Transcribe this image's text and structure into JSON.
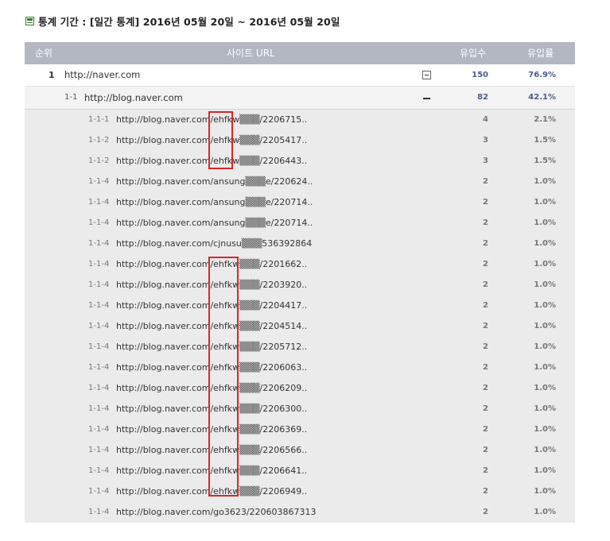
{
  "header": {
    "text": "통계 기간 : [일간 통계] 2016년 05월 20일 ~ 2016년 05월 20일"
  },
  "table": {
    "columns": {
      "rank": "순위",
      "url": "사이트 URL",
      "count": "유입수",
      "rate": "유입률"
    },
    "top": {
      "rank": "1",
      "url": "http://naver.com",
      "count": "150",
      "rate": "76.9%"
    },
    "sub": {
      "rank": "1-1",
      "url": "http://blog.naver.com",
      "count": "82",
      "rate": "42.1%"
    },
    "rows": [
      {
        "rank": "1-1-1",
        "url": "http://blog.naver.com/ehfkw▒▒▒/2206715..",
        "count": "4",
        "rate": "2.1%"
      },
      {
        "rank": "1-1-2",
        "url": "http://blog.naver.com/ehfkw▒▒▒/2205417..",
        "count": "3",
        "rate": "1.5%"
      },
      {
        "rank": "1-1-2",
        "url": "http://blog.naver.com/ehfkw▒▒▒/2206443..",
        "count": "3",
        "rate": "1.5%"
      },
      {
        "rank": "1-1-4",
        "url": "http://blog.naver.com/ansung▒▒▒e/220624..",
        "count": "2",
        "rate": "1.0%"
      },
      {
        "rank": "1-1-4",
        "url": "http://blog.naver.com/ansung▒▒▒e/220714..",
        "count": "2",
        "rate": "1.0%"
      },
      {
        "rank": "1-1-4",
        "url": "http://blog.naver.com/ansung▒▒▒e/220714..",
        "count": "2",
        "rate": "1.0%"
      },
      {
        "rank": "1-1-4",
        "url": "http://blog.naver.com/cjnusu▒▒▒536392864",
        "count": "2",
        "rate": "1.0%"
      },
      {
        "rank": "1-1-4",
        "url": "http://blog.naver.com/ehfkw▒▒▒/2201662..",
        "count": "2",
        "rate": "1.0%"
      },
      {
        "rank": "1-1-4",
        "url": "http://blog.naver.com/ehfkw▒▒▒/2203920..",
        "count": "2",
        "rate": "1.0%"
      },
      {
        "rank": "1-1-4",
        "url": "http://blog.naver.com/ehfkw▒▒▒/2204417..",
        "count": "2",
        "rate": "1.0%"
      },
      {
        "rank": "1-1-4",
        "url": "http://blog.naver.com/ehfkw▒▒▒/2204514..",
        "count": "2",
        "rate": "1.0%"
      },
      {
        "rank": "1-1-4",
        "url": "http://blog.naver.com/ehfkw▒▒▒/2205712..",
        "count": "2",
        "rate": "1.0%"
      },
      {
        "rank": "1-1-4",
        "url": "http://blog.naver.com/ehfkw▒▒▒/2206063..",
        "count": "2",
        "rate": "1.0%"
      },
      {
        "rank": "1-1-4",
        "url": "http://blog.naver.com/ehfkw▒▒▒/2206209..",
        "count": "2",
        "rate": "1.0%"
      },
      {
        "rank": "1-1-4",
        "url": "http://blog.naver.com/ehfkw▒▒▒/2206300..",
        "count": "2",
        "rate": "1.0%"
      },
      {
        "rank": "1-1-4",
        "url": "http://blog.naver.com/ehfkw▒▒▒/2206369..",
        "count": "2",
        "rate": "1.0%"
      },
      {
        "rank": "1-1-4",
        "url": "http://blog.naver.com/ehfkw▒▒▒/2206566..",
        "count": "2",
        "rate": "1.0%"
      },
      {
        "rank": "1-1-4",
        "url": "http://blog.naver.com/ehfkw▒▒▒/2206641..",
        "count": "2",
        "rate": "1.0%"
      },
      {
        "rank": "1-1-4",
        "url": "http://blog.naver.com/ehfkw▒▒▒/2206949..",
        "count": "2",
        "rate": "1.0%"
      },
      {
        "rank": "1-1-4",
        "url": "http://blog.naver.com/go3623/220603867313",
        "count": "2",
        "rate": "1.0%"
      }
    ]
  },
  "colors": {
    "header_bg": "#b2b7c0",
    "highlight": "#d9262a",
    "count_color": "#4a5d8a"
  }
}
